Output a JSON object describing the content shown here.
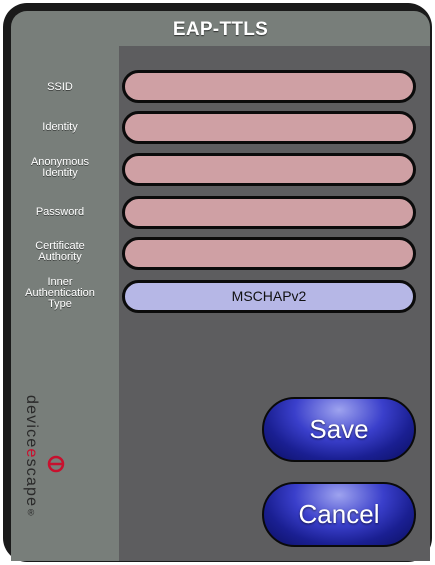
{
  "window": {
    "title": "EAP-TTLS"
  },
  "fields": [
    {
      "label": "SSID",
      "value": ""
    },
    {
      "label": "Identity",
      "value": ""
    },
    {
      "label": "Anonymous Identity",
      "value": ""
    },
    {
      "label": "Password",
      "value": ""
    },
    {
      "label": "Certificate Authority",
      "value": ""
    },
    {
      "label": "Inner Authentication Type",
      "value": "MSCHAPv2"
    }
  ],
  "logo": {
    "brand_pre": "device",
    "brand_accent": "e",
    "brand_post": "scape",
    "trademark": "®"
  },
  "buttons": {
    "save_label": "Save",
    "cancel_label": "Cancel"
  },
  "colors": {
    "field_fill": "#cfa0a4",
    "select_fill": "#b6b7e6",
    "button_blue": "#2a2fb0",
    "brand_accent": "#c8102e"
  }
}
